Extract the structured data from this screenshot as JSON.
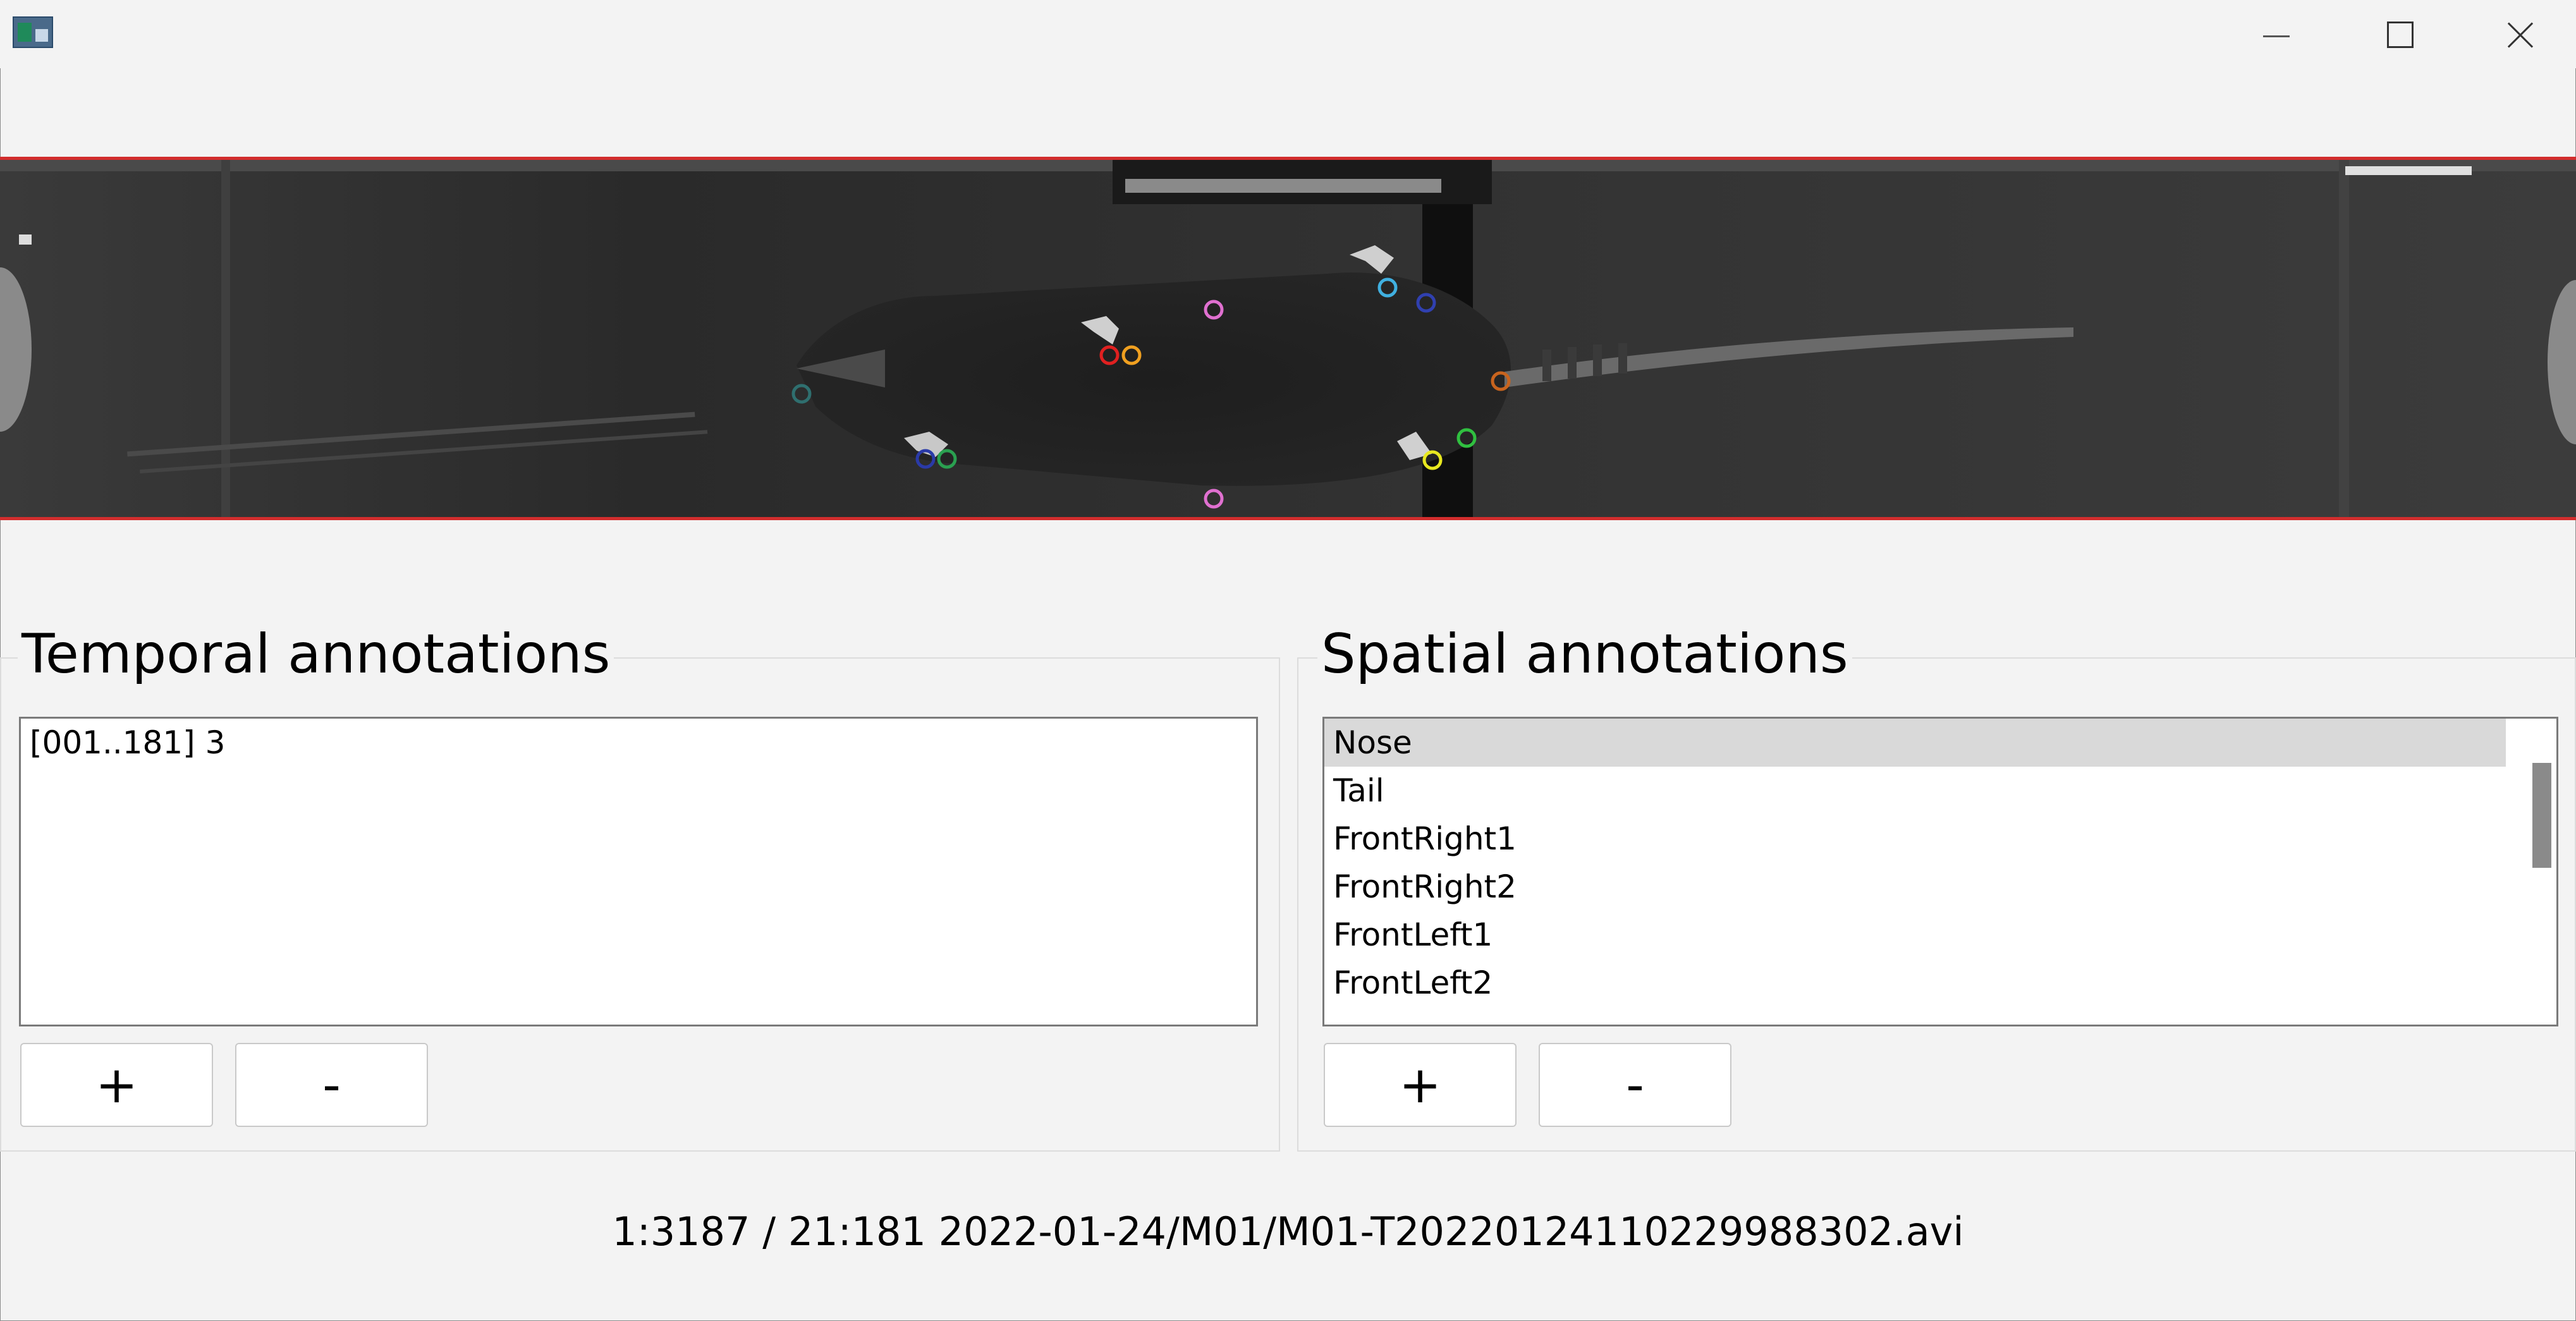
{
  "temporal": {
    "title": "Temporal annotations",
    "items": [
      "[001..181] 3"
    ],
    "add_label": "+",
    "remove_label": "-"
  },
  "spatial": {
    "title": "Spatial annotations",
    "items": [
      "Nose",
      "Tail",
      "FrontRight1",
      "FrontRight2",
      "FrontLeft1",
      "FrontLeft2"
    ],
    "selected_index": 0,
    "add_label": "+",
    "remove_label": "-"
  },
  "status_text": "1:3187 / 21:181 2022-01-24/M01/M01-T20220124110229988302.avi",
  "colors": {
    "video_frame_border": "#d22d2d",
    "marker_nose": "#2f6f6f",
    "marker_tail": "#c8641e",
    "marker_front_right_1": "#e02020",
    "marker_front_right_2": "#f0a020",
    "marker_front_left_1": "#2a3aa8",
    "marker_front_left_2": "#2aa050",
    "marker_hind_left_1": "#40b0e0",
    "marker_hind_left_2": "#3040b0",
    "marker_hind_right_1": "#e8e820",
    "marker_hind_right_2": "#30c040",
    "marker_side": "#e070d0"
  }
}
